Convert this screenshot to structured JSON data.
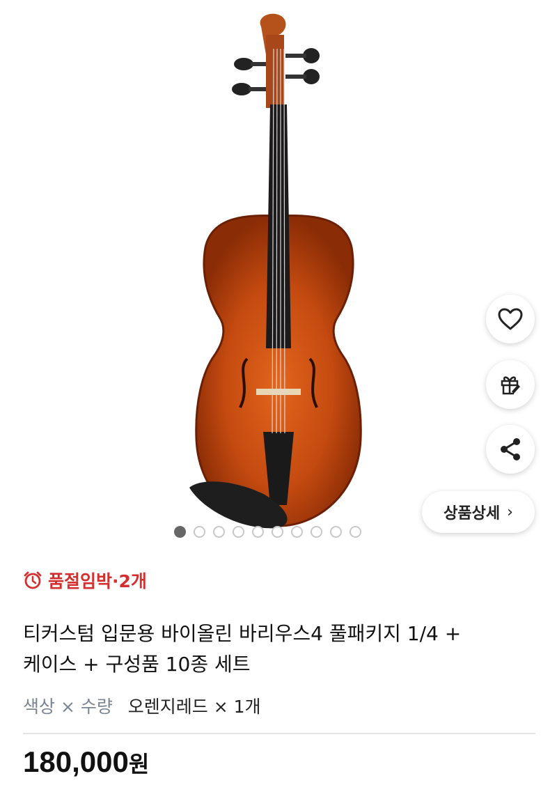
{
  "gallery": {
    "image": "violin-product-photo",
    "image_count": 10,
    "active_index": 0,
    "side_actions": [
      {
        "icon": "heart-icon"
      },
      {
        "icon": "gift-icon"
      },
      {
        "icon": "share-icon"
      }
    ],
    "detail_button": {
      "label": "상품상세",
      "chevron": "›"
    }
  },
  "stock": {
    "icon": "alarm-clock-icon",
    "label": "품절임박·2개",
    "color": "#d32f2f"
  },
  "product": {
    "title_line1": "티커스텀 입문용 바이올린 바리우스4 풀패키지 1/4 +",
    "title_line2": "케이스 + 구성품 10종 세트"
  },
  "option": {
    "label": "색상 × 수량",
    "value": "오렌지레드 × 1개"
  },
  "price": {
    "amount": "180,000",
    "unit": "원"
  }
}
